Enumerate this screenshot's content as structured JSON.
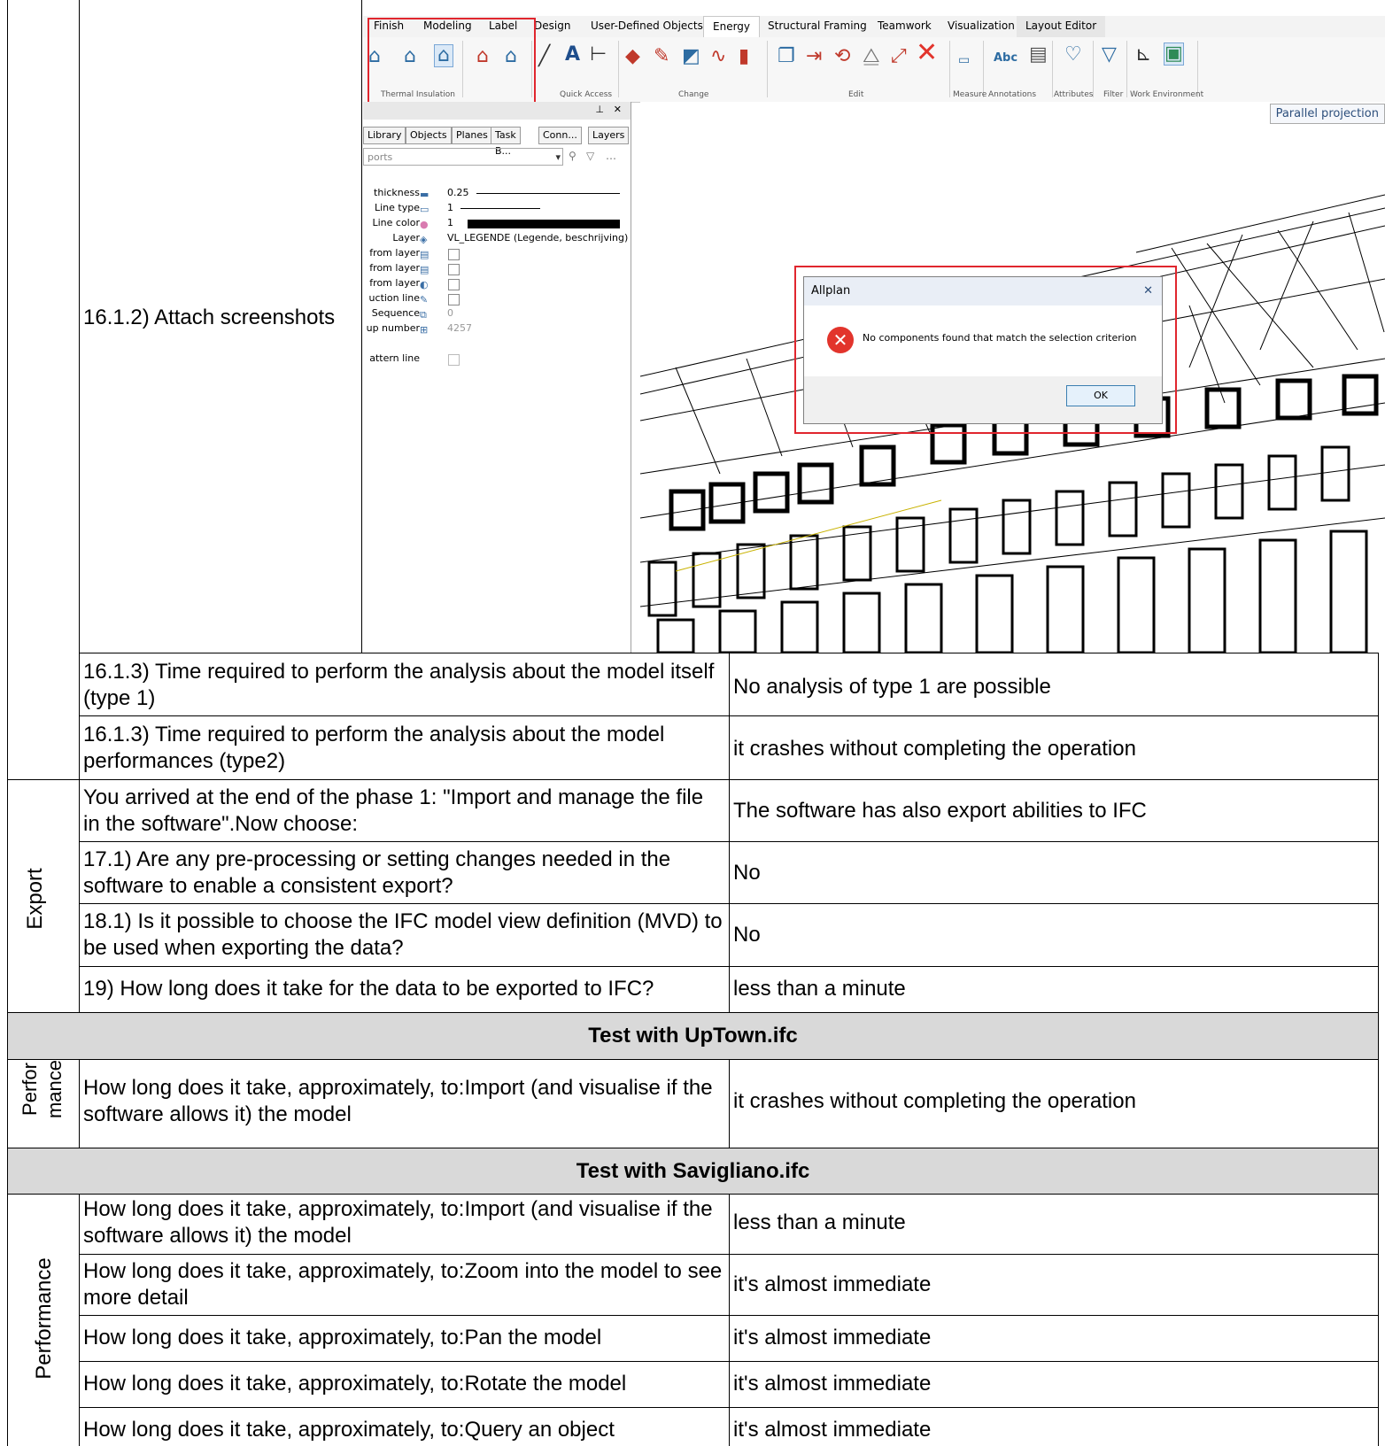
{
  "row_screens": {
    "label": "16.1.2) Attach screenshots"
  },
  "screenshot": {
    "ribbon_tabs": [
      "Finish",
      "Modeling",
      "Label",
      "Design",
      "User-Defined Objects",
      "Energy",
      "Structural Framing",
      "Teamwork",
      "Visualization",
      "Layout Editor"
    ],
    "active_tab": "Energy",
    "groups": [
      "Thermal Insulation",
      "Quick Access",
      "Change",
      "Edit",
      "Measure",
      "Annotations",
      "Attributes",
      "Filter",
      "Work Environment"
    ],
    "panel_tabs": [
      "Library",
      "Objects",
      "Planes",
      "Task B...",
      "Conn...",
      "Layers"
    ],
    "panel_search": "ports",
    "props": [
      {
        "label": "thickness",
        "value": "0.25"
      },
      {
        "label": "Line type",
        "value": "1"
      },
      {
        "label": "Line color",
        "value": "1"
      },
      {
        "label": "Layer",
        "value": "VL_LEGENDE (Legende, beschrijving)"
      },
      {
        "label": "from layer",
        "value": ""
      },
      {
        "label": "from layer",
        "value": ""
      },
      {
        "label": "from layer",
        "value": ""
      },
      {
        "label": "uction line",
        "value": ""
      },
      {
        "label": "Sequence",
        "value": "0"
      },
      {
        "label": "up number",
        "value": "4257"
      },
      {
        "label": "attern line",
        "value": ""
      }
    ],
    "projection_label": "Parallel projection",
    "dialog": {
      "title": "Allplan",
      "message": "No components found that match the selection criterion",
      "ok": "OK"
    },
    "colors": {
      "highlight": "#e0262e",
      "error": "#e2342c"
    }
  },
  "rows": [
    {
      "q": "16.1.3) Time required to perform the analysis about the model itself (type 1)",
      "a": "No analysis of type 1 are possible"
    },
    {
      "q": "16.1.3) Time required to perform the analysis about the model performances (type2)",
      "a": "it crashes without completing the operation"
    },
    {
      "q": "You arrived at the end of the phase 1: \"Import and manage the file in the software\".Now choose:",
      "a": "The software has also export abilities to IFC"
    },
    {
      "q": "17.1) Are any pre-processing or setting changes needed in the software to enable a consistent export?",
      "a": "No"
    },
    {
      "q": "18.1) Is it possible to choose the IFC model view definition (MVD) to be used when exporting the data?",
      "a": "No"
    },
    {
      "q": "19) How long does it take for the data to be exported to IFC?",
      "a": "less than a minute"
    }
  ],
  "export_label": "Export",
  "section_uptown": {
    "title": "Test with UpTown.ifc",
    "side_label_1": "Perfor",
    "side_label_2": "mance",
    "q": "How long does it take, approximately, to:Import (and visualise if the software allows it) the model",
    "a": "it crashes without completing the operation"
  },
  "section_savigliano": {
    "title": "Test with Savigliano.ifc",
    "side_label": "Performance",
    "rows": [
      {
        "q": "How long does it take, approximately, to:Import (and visualise if the software allows it) the model",
        "a": "less than a minute"
      },
      {
        "q": "How long does it take, approximately, to:Zoom into the model to see more detail",
        "a": "it's almost immediate"
      },
      {
        "q": "How long does it take, approximately, to:Pan the model",
        "a": "it's almost immediate"
      },
      {
        "q": "How long does it take, approximately, to:Rotate the model",
        "a": "it's almost immediate"
      },
      {
        "q": "How long does it take, approximately, to:Query an object",
        "a": "it's almost immediate"
      }
    ]
  }
}
